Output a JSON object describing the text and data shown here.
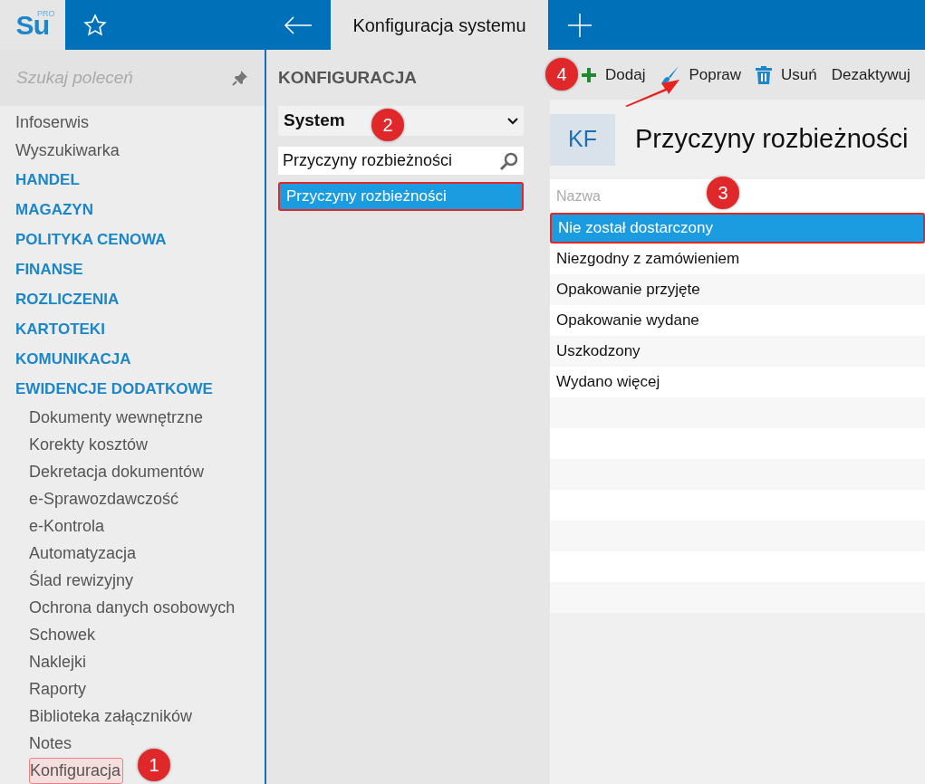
{
  "top_bar": {
    "logo": {
      "text": "Su",
      "superscript": "PRO"
    },
    "tab_title": "Konfiguracja systemu"
  },
  "sidebar": {
    "search": {
      "placeholder": "Szukaj poleceń"
    },
    "items": [
      {
        "kind": "item",
        "label": "Infoserwis",
        "selected": false
      },
      {
        "kind": "item",
        "label": "Wyszukiwarka",
        "selected": false
      },
      {
        "kind": "section",
        "label": "HANDEL",
        "selected": false
      },
      {
        "kind": "section",
        "label": "MAGAZYN",
        "selected": false
      },
      {
        "kind": "section",
        "label": "POLITYKA CENOWA",
        "selected": false
      },
      {
        "kind": "section",
        "label": "FINANSE",
        "selected": false
      },
      {
        "kind": "section",
        "label": "ROZLICZENIA",
        "selected": false
      },
      {
        "kind": "section",
        "label": "KARTOTEKI",
        "selected": false
      },
      {
        "kind": "section",
        "label": "KOMUNIKACJA",
        "selected": false
      },
      {
        "kind": "section",
        "label": "EWIDENCJE DODATKOWE",
        "selected": false
      },
      {
        "kind": "subitem",
        "label": "Dokumenty wewnętrzne",
        "selected": false
      },
      {
        "kind": "subitem",
        "label": "Korekty kosztów",
        "selected": false
      },
      {
        "kind": "subitem",
        "label": "Dekretacja dokumentów",
        "selected": false
      },
      {
        "kind": "subitem",
        "label": "e-Sprawozdawczość",
        "selected": false
      },
      {
        "kind": "subitem",
        "label": "e-Kontrola",
        "selected": false
      },
      {
        "kind": "subitem",
        "label": "Automatyzacja",
        "selected": false
      },
      {
        "kind": "subitem",
        "label": "Ślad rewizyjny",
        "selected": false
      },
      {
        "kind": "subitem",
        "label": "Ochrona danych osobowych",
        "selected": false
      },
      {
        "kind": "subitem",
        "label": "Schowek",
        "selected": false
      },
      {
        "kind": "subitem",
        "label": "Naklejki",
        "selected": false
      },
      {
        "kind": "subitem",
        "label": "Raporty",
        "selected": false
      },
      {
        "kind": "subitem",
        "label": "Biblioteka załączników",
        "selected": false
      },
      {
        "kind": "subitem",
        "label": "Notes",
        "selected": false
      },
      {
        "kind": "subitem",
        "label": "Konfiguracja",
        "selected": true
      }
    ]
  },
  "config_panel": {
    "title": "KONFIGURACJA",
    "dropdown": {
      "value": "System"
    },
    "search": {
      "value": "Przyczyny rozbieżności"
    },
    "results": [
      {
        "label": "Przyczyny rozbieżności",
        "selected": true
      }
    ]
  },
  "toolbar": {
    "buttons": [
      {
        "kind": "add",
        "label": "Dodaj"
      },
      {
        "kind": "edit",
        "label": "Popraw"
      },
      {
        "kind": "delete",
        "label": "Usuń"
      },
      {
        "kind": "plain",
        "label": "Dezaktywuj"
      }
    ]
  },
  "content": {
    "badge": "KF",
    "title": "Przyczyny rozbieżności",
    "table": {
      "columns": [
        "Nazwa"
      ],
      "rows": [
        {
          "name": "Nie został dostarczony",
          "selected": true
        },
        {
          "name": "Niezgodny z zamówieniem",
          "selected": false
        },
        {
          "name": "Opakowanie przyjęte",
          "selected": false
        },
        {
          "name": "Opakowanie wydane",
          "selected": false
        },
        {
          "name": "Uszkodzony",
          "selected": false
        },
        {
          "name": "Wydano więcej",
          "selected": false
        }
      ]
    }
  },
  "callouts": [
    "1",
    "2",
    "3",
    "4"
  ]
}
